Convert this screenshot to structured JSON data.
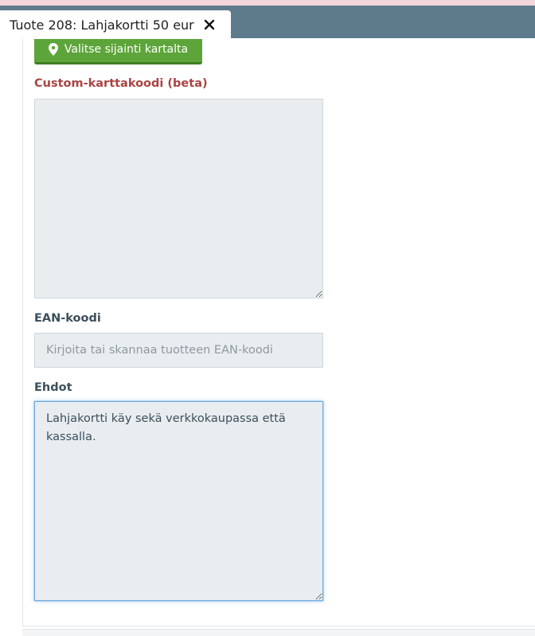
{
  "tab": {
    "title": "Tuote 208: Lahjakortti 50 eur",
    "close_icon": "close-icon"
  },
  "map_button": {
    "label": "Valitse sijainti kartalta",
    "icon": "map-marker-icon"
  },
  "form": {
    "custom_map_code": {
      "label": "Custom-karttakoodi (beta)",
      "value": ""
    },
    "ean_code": {
      "label": "EAN-koodi",
      "placeholder": "Kirjoita tai skannaa tuotteen EAN-koodi",
      "value": ""
    },
    "terms": {
      "label": "Ehdot",
      "value": "Lahjakortti käy sekä verkkokaupassa että kassalla."
    }
  },
  "colors": {
    "tab_bar": "#5e7b8c",
    "button_green": "#5da53a",
    "label_red": "#a94442",
    "label_dark": "#3c4f5c",
    "focus_blue": "#74a9d8"
  }
}
